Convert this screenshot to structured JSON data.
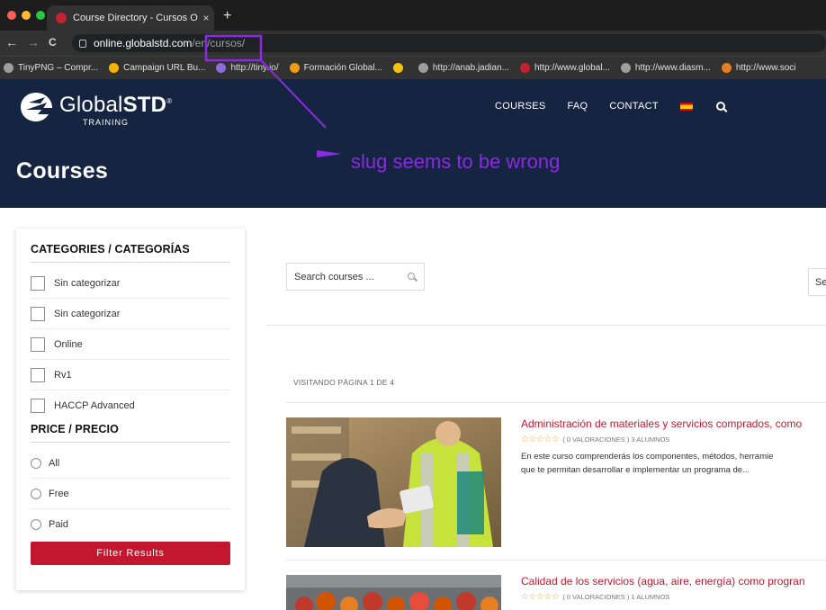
{
  "browser": {
    "tab_title": "Course Directory - Cursos Onli",
    "tab_close": "×",
    "new_tab": "+",
    "back": "←",
    "forward": "→",
    "reload": "C",
    "url_domain": "online.globalstd.com",
    "url_path": "/en/cursos/",
    "bookmarks": [
      {
        "label": "TinyPNG – Compr...",
        "color": "#9e9e9e"
      },
      {
        "label": "Campaign URL Bu...",
        "color": "#f4b400"
      },
      {
        "label": "http://tiny.io/",
        "color": "#8e6bd9"
      },
      {
        "label": "Formación Global...",
        "color": "#f39c12"
      },
      {
        "label": "",
        "color": "#f4c20d"
      },
      {
        "label": "http://anab.jadian...",
        "color": "#9e9e9e"
      },
      {
        "label": "http://www.global...",
        "color": "#c3232e"
      },
      {
        "label": "http://www.diasm...",
        "color": "#9e9e9e"
      },
      {
        "label": "http://www.soci",
        "color": "#e67e22"
      }
    ]
  },
  "site": {
    "logo_text_light": "Global",
    "logo_text_bold": "STD",
    "logo_registered": "®",
    "logo_subtitle": "TRAINING",
    "nav": {
      "courses": "COURSES",
      "faq": "FAQ",
      "contact": "CONTACT"
    },
    "page_title": "Courses",
    "brand_color": "#142441",
    "accent_color": "#c3172f"
  },
  "annotation": {
    "text": "slug seems to be wrong",
    "color": "#8a2be2"
  },
  "sidebar": {
    "categories_title": "CATEGORIES / CATEGORÍAS",
    "categories": [
      "Sin categorizar",
      "Sin categorizar",
      "Online",
      "Rv1",
      "HACCP Advanced"
    ],
    "price_title": "PRICE / PRECIO",
    "prices": [
      "All",
      "Free",
      "Paid"
    ],
    "filter_button": "Filter Results"
  },
  "main": {
    "search_placeholder": "Search courses ...",
    "sort_label": "Se",
    "pagination": "VISITANDO PÁGINA 1 DE 4",
    "courses": [
      {
        "title": "Administración de materiales y servicios comprados, como",
        "stars": "☆☆☆☆☆",
        "ratings": "( 0 VALORACIONES )",
        "students": "3 ALUMNOS",
        "desc_line1": "En este curso comprenderás los componentes, métodos, herramie",
        "desc_line2": "que te permitan desarrollar e implementar un programa de..."
      },
      {
        "title": "Calidad de los servicios (agua, aire, energía) como progran",
        "stars": "☆☆☆☆☆",
        "ratings": "( 0 VALORACIONES )",
        "students": "1 ALUMNOS"
      }
    ]
  }
}
